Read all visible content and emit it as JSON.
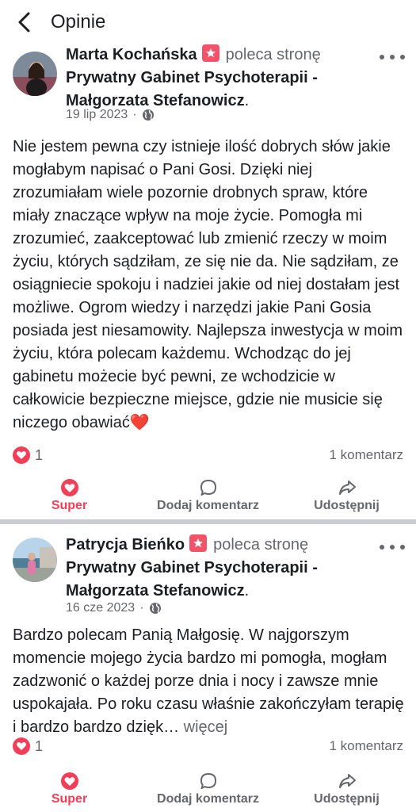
{
  "header": {
    "title": "Opinie"
  },
  "posts": [
    {
      "author": "Marta Kochańska",
      "recommends": "poleca stronę",
      "page": "Prywatny Gabinet Psychoterapii - Małgorzata Stefanowicz",
      "page_suffix": ".",
      "date": "19 lip 2023",
      "text": "Nie jestem pewna czy istnieje ilość dobrych słów jakie mogłabym napisać o Pani Gosi. Dzięki niej zrozumiałam wiele pozornie drobnych spraw, które miały znaczące wpływ na moje życie. Pomogła mi zrozumieć, zaakceptować lub zmienić rzeczy w moim życiu, których sądziłam, ze się nie da. Nie sądziłam, ze osiągniecie spokoju i nadziei jakie od niej dostałam jest możliwe. Ogrom wiedzy i narzędzi jakie Pani Gosia posiada jest niesamowity. Najlepsza inwestycja w moim życiu, która polecam każdemu. Wchodząc do jej gabinetu możecie być pewni, ze wchodzicie w całkowicie bezpieczne miejsce, gdzie nie musicie się niczego obawiać❤️",
      "more_label": "",
      "reactions": "1",
      "comments": "1 komentarz",
      "avatar_color": "#6a7c8e"
    },
    {
      "author": "Patrycja Bieńko",
      "recommends": "poleca stronę",
      "page": "Prywatny Gabinet Psychoterapii - Małgorzata Stefanowicz",
      "page_suffix": ".",
      "date": "16 cze 2023",
      "text": "Bardzo polecam Panią Małgosię. W najgorszym momencie mojego życia bardzo mi pomogła, mogłam zadzwonić o każdej porze dnia i nocy i zawsze mnie uspokajała. Po roku czasu właśnie zakończyłam terapię i bardzo bardzo dzięk…",
      "more_label": " więcej",
      "reactions": "1",
      "comments": "1 komentarz",
      "avatar_color": "#8fb8d8"
    }
  ],
  "actions": {
    "super": "Super",
    "comment": "Dodaj komentarz",
    "share": "Udostępnij"
  },
  "colors": {
    "accent": "#f33e58",
    "secondary_text": "#65676b",
    "separator": "#c9ccd1"
  }
}
